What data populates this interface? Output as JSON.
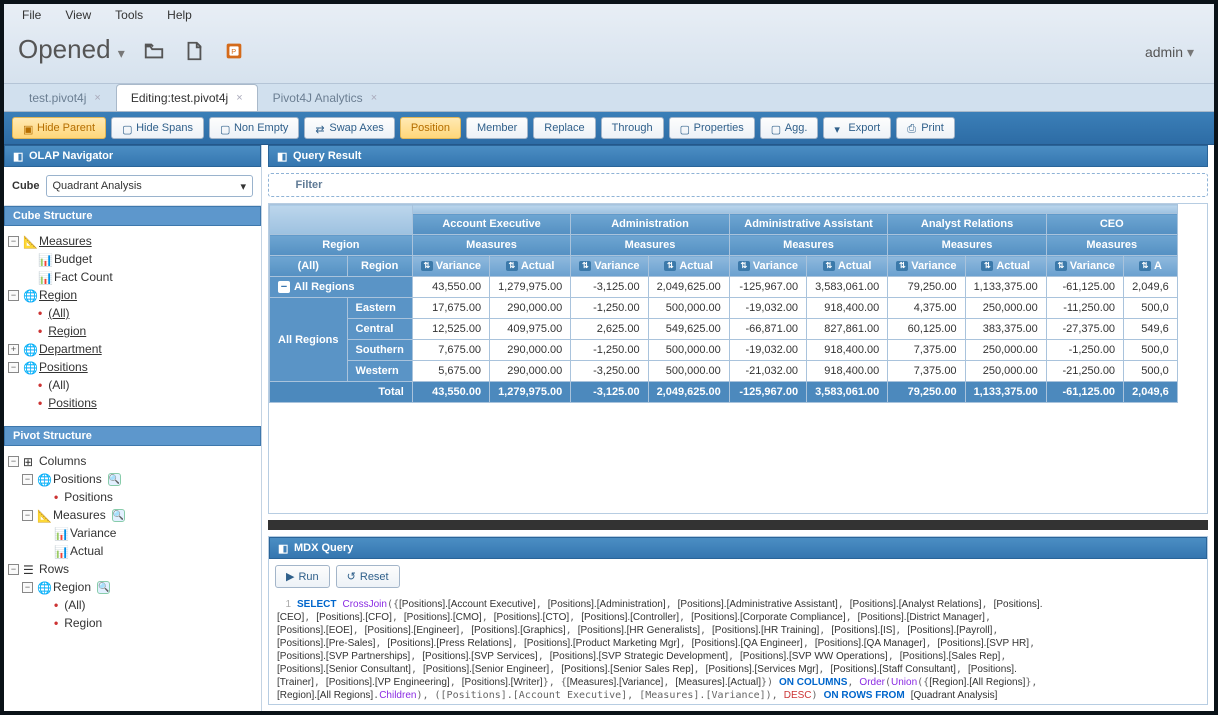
{
  "menu": {
    "file": "File",
    "view": "View",
    "tools": "Tools",
    "help": "Help"
  },
  "opened": "Opened",
  "user": "admin",
  "tabs": [
    {
      "label": "test.pivot4j",
      "active": false,
      "closable": true
    },
    {
      "label": "Editing:test.pivot4j",
      "active": true,
      "closable": true
    },
    {
      "label": "Pivot4J Analytics",
      "active": false,
      "closable": true
    }
  ],
  "toolbar": [
    {
      "label": "Hide Parent",
      "active": true
    },
    {
      "label": "Hide Spans"
    },
    {
      "label": "Non Empty"
    },
    {
      "label": "Swap Axes"
    },
    {
      "label": "Position",
      "active": true
    },
    {
      "label": "Member"
    },
    {
      "label": "Replace"
    },
    {
      "label": "Through"
    },
    {
      "label": "Properties"
    },
    {
      "label": "Agg."
    },
    {
      "label": "Export"
    },
    {
      "label": "Print"
    }
  ],
  "panels": {
    "nav": "OLAP Navigator",
    "result": "Query Result",
    "mdx": "MDX Query"
  },
  "cube": {
    "label": "Cube",
    "value": "Quadrant Analysis"
  },
  "sections": {
    "cube": "Cube Structure",
    "pivot": "Pivot Structure"
  },
  "cubetree": {
    "measures": "Measures",
    "budget": "Budget",
    "fact": "Fact Count",
    "region": "Region",
    "all": "(All)",
    "regionLeaf": "Region",
    "department": "Department",
    "positions": "Positions",
    "positionsLeaf": "Positions"
  },
  "pivottree": {
    "columns": "Columns",
    "positions": "Positions",
    "positionsLeaf": "Positions",
    "measures": "Measures",
    "variance": "Variance",
    "actual": "Actual",
    "rows": "Rows",
    "region": "Region",
    "all": "(All)",
    "regionLeaf": "Region"
  },
  "filter": "Filter",
  "grid": {
    "region": "Region",
    "all": "(All)",
    "regionCol": "Region",
    "measures": "Measures",
    "groups": [
      "Account Executive",
      "Administration",
      "Administrative Assistant",
      "Analyst Relations",
      "CEO"
    ],
    "cols": [
      "Variance",
      "Actual"
    ],
    "rows": [
      {
        "l1": "All Regions",
        "l2": "",
        "v": [
          "43,550.00",
          "1,279,975.00",
          "-3,125.00",
          "2,049,625.00",
          "-125,967.00",
          "3,583,061.00",
          "79,250.00",
          "1,133,375.00",
          "-61,125.00",
          "2,049,6"
        ]
      },
      {
        "l1": "All Regions",
        "l2": "Eastern",
        "v": [
          "17,675.00",
          "290,000.00",
          "-1,250.00",
          "500,000.00",
          "-19,032.00",
          "918,400.00",
          "4,375.00",
          "250,000.00",
          "-11,250.00",
          "500,0"
        ]
      },
      {
        "l1": "",
        "l2": "Central",
        "v": [
          "12,525.00",
          "409,975.00",
          "2,625.00",
          "549,625.00",
          "-66,871.00",
          "827,861.00",
          "60,125.00",
          "383,375.00",
          "-27,375.00",
          "549,6"
        ]
      },
      {
        "l1": "",
        "l2": "Southern",
        "v": [
          "7,675.00",
          "290,000.00",
          "-1,250.00",
          "500,000.00",
          "-19,032.00",
          "918,400.00",
          "7,375.00",
          "250,000.00",
          "-1,250.00",
          "500,0"
        ]
      },
      {
        "l1": "",
        "l2": "Western",
        "v": [
          "5,675.00",
          "290,000.00",
          "-3,250.00",
          "500,000.00",
          "-21,032.00",
          "918,400.00",
          "7,375.00",
          "250,000.00",
          "-21,250.00",
          "500,0"
        ]
      }
    ],
    "total": {
      "label": "Total",
      "v": [
        "43,550.00",
        "1,279,975.00",
        "-3,125.00",
        "2,049,625.00",
        "-125,967.00",
        "3,583,061.00",
        "79,250.00",
        "1,133,375.00",
        "-61,125.00",
        "2,049,6"
      ]
    }
  },
  "mdx": {
    "run": "Run",
    "reset": "Reset"
  }
}
